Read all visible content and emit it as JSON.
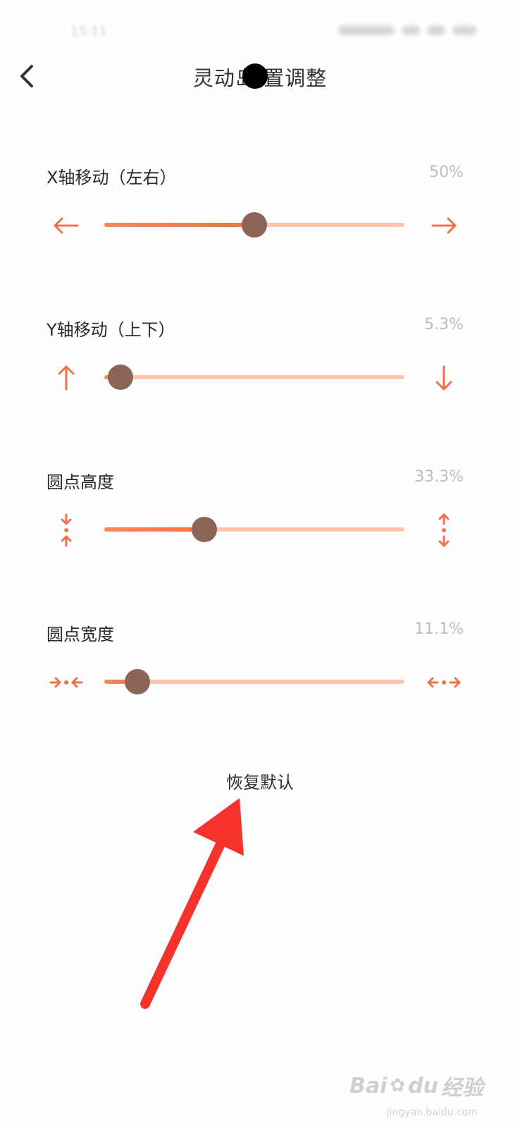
{
  "status_bar": {
    "time": "15:11"
  },
  "header": {
    "title": "灵动岛  置调整"
  },
  "settings": [
    {
      "label": "X轴移动（左右）",
      "value_text": "50%",
      "level": 0.5,
      "icon_left": "arrow-left-icon",
      "icon_right": "arrow-right-icon"
    },
    {
      "label": "Y轴移动（上下）",
      "value_text": "5.3%",
      "level": 0.053,
      "icon_left": "arrow-up-icon",
      "icon_right": "arrow-down-icon"
    },
    {
      "label": "圆点高度",
      "value_text": "33.3%",
      "level": 0.333,
      "icon_left": "compress-vertical-icon",
      "icon_right": "expand-vertical-icon"
    },
    {
      "label": "圆点宽度",
      "value_text": "11.1%",
      "level": 0.111,
      "icon_left": "compress-horizontal-icon",
      "icon_right": "expand-horizontal-icon"
    }
  ],
  "restore_label": "恢复默认",
  "watermark": {
    "brand": "Bai",
    "brand_suffix": "du",
    "cn": "经验",
    "site": "jingyan.baidu.com"
  },
  "colors": {
    "accent": "#f0714a",
    "track": "#fbc6ae",
    "thumb": "#8a6457",
    "annotation": "#f5322c"
  }
}
